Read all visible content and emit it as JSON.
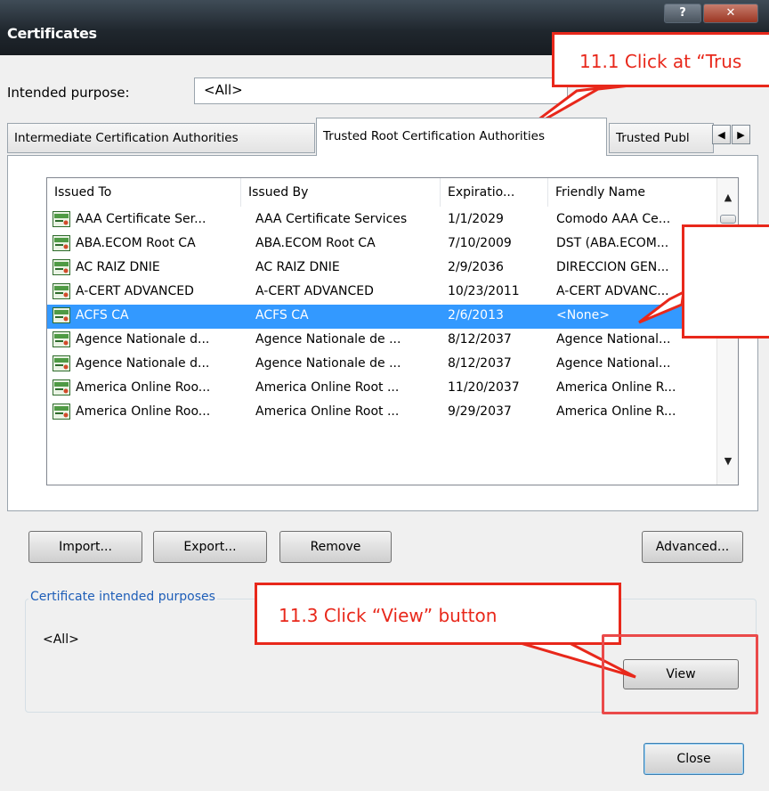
{
  "window": {
    "title": "Certificates",
    "help_glyph": "?",
    "close_glyph": "✕"
  },
  "purpose": {
    "label": "Intended purpose:",
    "value": "<All>"
  },
  "tabs": [
    {
      "label": "Intermediate Certification Authorities"
    },
    {
      "label": "Trusted Root Certification Authorities",
      "active": true
    },
    {
      "label": "Trusted Publ"
    }
  ],
  "tab_scroll": {
    "left": "◀",
    "right": "▶"
  },
  "list": {
    "columns": [
      "Issued To",
      "Issued By",
      "Expiratio...",
      "Friendly Name"
    ],
    "rows": [
      {
        "issued_to": "AAA Certificate Ser...",
        "issued_by": "AAA Certificate Services",
        "expiration": "1/1/2029",
        "friendly": "Comodo AAA Ce..."
      },
      {
        "issued_to": "ABA.ECOM Root CA",
        "issued_by": "ABA.ECOM Root CA",
        "expiration": "7/10/2009",
        "friendly": "DST (ABA.ECOM..."
      },
      {
        "issued_to": "AC RAIZ DNIE",
        "issued_by": "AC RAIZ DNIE",
        "expiration": "2/9/2036",
        "friendly": "DIRECCION GEN..."
      },
      {
        "issued_to": "A-CERT ADVANCED",
        "issued_by": "A-CERT ADVANCED",
        "expiration": "10/23/2011",
        "friendly": "A-CERT ADVANC..."
      },
      {
        "issued_to": "ACFS CA",
        "issued_by": "ACFS CA",
        "expiration": "2/6/2013",
        "friendly": "<None>",
        "selected": true
      },
      {
        "issued_to": "Agence Nationale d...",
        "issued_by": "Agence Nationale de ...",
        "expiration": "8/12/2037",
        "friendly": "Agence National..."
      },
      {
        "issued_to": "Agence Nationale d...",
        "issued_by": "Agence Nationale de ...",
        "expiration": "8/12/2037",
        "friendly": "Agence National..."
      },
      {
        "issued_to": "America Online Roo...",
        "issued_by": "America Online Root ...",
        "expiration": "11/20/2037",
        "friendly": "America Online R..."
      },
      {
        "issued_to": "America Online Roo...",
        "issued_by": "America Online Root ...",
        "expiration": "9/29/2037",
        "friendly": "America Online R..."
      }
    ]
  },
  "buttons": {
    "import": "Import...",
    "export": "Export...",
    "remove": "Remove",
    "advanced": "Advanced...",
    "view": "View",
    "close": "Close"
  },
  "purposes_group": {
    "label": "Certificate intended purposes",
    "value": "<All>"
  },
  "annotations": {
    "step1": "11.1 Click at “Trus",
    "step3": "11.3 Click “View” button"
  },
  "colors": {
    "selection": "#3399ff",
    "annotation_red": "#e8281b",
    "titlebar": "#20272e"
  }
}
